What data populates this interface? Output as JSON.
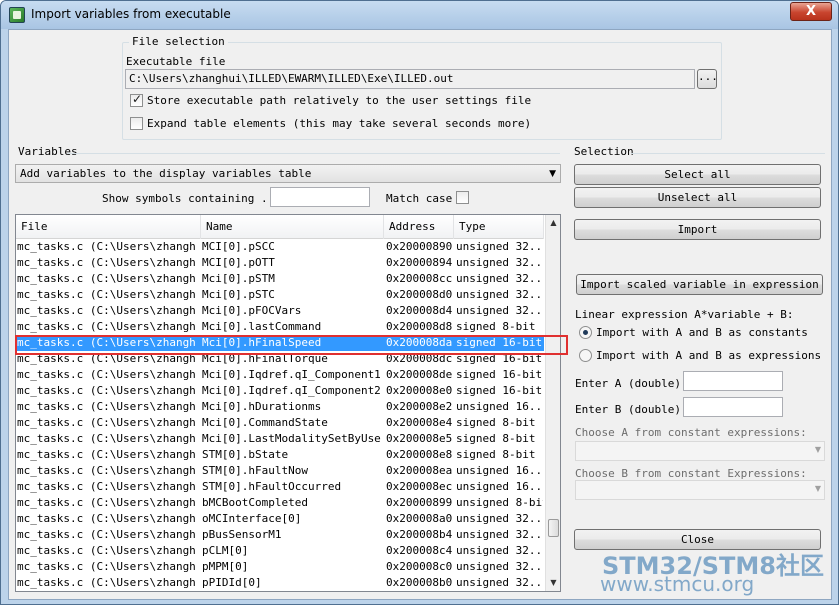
{
  "window": {
    "title": "Import variables from executable",
    "close_label": "X"
  },
  "file_selection": {
    "title": "File selection",
    "executable_label": "Executable file",
    "executable_path": "C:\\Users\\zhanghui\\ILLED\\EWARM\\ILLED\\Exe\\ILLED.out",
    "browse_label": "...",
    "store_relative_label": "Store executable path relatively to the user settings file",
    "store_relative_checked": true,
    "expand_table_label": "Expand table elements (this may take several seconds more)",
    "expand_table_checked": false
  },
  "variables": {
    "title": "Variables",
    "action_select_value": "Add variables to the display variables table",
    "show_symbols_label": "Show symbols containing ...",
    "show_symbols_value": "",
    "match_case_label": "Match case",
    "match_case_checked": false,
    "columns": [
      "File",
      "Name",
      "Address",
      "Type"
    ],
    "rows": [
      {
        "file": "mc_tasks.c (C:\\Users\\zhangh...",
        "name": "MCI[0].pSCC",
        "address": "0x20000890",
        "type": "unsigned 32..."
      },
      {
        "file": "mc_tasks.c (C:\\Users\\zhangh...",
        "name": "MCI[0].pOTT",
        "address": "0x20000894",
        "type": "unsigned 32..."
      },
      {
        "file": "mc_tasks.c (C:\\Users\\zhangh...",
        "name": "Mci[0].pSTM",
        "address": "0x200008cc",
        "type": "unsigned 32..."
      },
      {
        "file": "mc_tasks.c (C:\\Users\\zhangh...",
        "name": "Mci[0].pSTC",
        "address": "0x200008d0",
        "type": "unsigned 32..."
      },
      {
        "file": "mc_tasks.c (C:\\Users\\zhangh...",
        "name": "Mci[0].pFOCVars",
        "address": "0x200008d4",
        "type": "unsigned 32..."
      },
      {
        "file": "mc_tasks.c (C:\\Users\\zhangh...",
        "name": "Mci[0].lastCommand",
        "address": "0x200008d8",
        "type": "signed 8-bit"
      },
      {
        "file": "mc_tasks.c (C:\\Users\\zhangh...",
        "name": "Mci[0].hFinalSpeed",
        "address": "0x200008da",
        "type": "signed 16-bit",
        "selected": true
      },
      {
        "file": "mc_tasks.c (C:\\Users\\zhangh...",
        "name": "Mci[0].hFinalTorque",
        "address": "0x200008dc",
        "type": "signed 16-bit"
      },
      {
        "file": "mc_tasks.c (C:\\Users\\zhangh...",
        "name": "Mci[0].Iqdref.qI_Component1",
        "address": "0x200008de",
        "type": "signed 16-bit"
      },
      {
        "file": "mc_tasks.c (C:\\Users\\zhangh...",
        "name": "Mci[0].Iqdref.qI_Component2",
        "address": "0x200008e0",
        "type": "signed 16-bit"
      },
      {
        "file": "mc_tasks.c (C:\\Users\\zhangh...",
        "name": "Mci[0].hDurationms",
        "address": "0x200008e2",
        "type": "unsigned 16..."
      },
      {
        "file": "mc_tasks.c (C:\\Users\\zhangh...",
        "name": "Mci[0].CommandState",
        "address": "0x200008e4",
        "type": "signed 8-bit"
      },
      {
        "file": "mc_tasks.c (C:\\Users\\zhangh...",
        "name": "Mci[0].LastModalitySetByUser",
        "address": "0x200008e5",
        "type": "signed 8-bit"
      },
      {
        "file": "mc_tasks.c (C:\\Users\\zhangh...",
        "name": "STM[0].bState",
        "address": "0x200008e8",
        "type": "signed 8-bit"
      },
      {
        "file": "mc_tasks.c (C:\\Users\\zhangh...",
        "name": "STM[0].hFaultNow",
        "address": "0x200008ea",
        "type": "unsigned 16..."
      },
      {
        "file": "mc_tasks.c (C:\\Users\\zhangh...",
        "name": "STM[0].hFaultOccurred",
        "address": "0x200008ec",
        "type": "unsigned 16..."
      },
      {
        "file": "mc_tasks.c (C:\\Users\\zhangh...",
        "name": "bMCBootCompleted",
        "address": "0x20000899",
        "type": "unsigned 8-bit"
      },
      {
        "file": "mc_tasks.c (C:\\Users\\zhangh...",
        "name": "oMCInterface[0]",
        "address": "0x200008a0",
        "type": "unsigned 32..."
      },
      {
        "file": "mc_tasks.c (C:\\Users\\zhangh...",
        "name": "pBusSensorM1",
        "address": "0x200008b4",
        "type": "unsigned 32..."
      },
      {
        "file": "mc_tasks.c (C:\\Users\\zhangh...",
        "name": "pCLM[0]",
        "address": "0x200008c4",
        "type": "unsigned 32..."
      },
      {
        "file": "mc_tasks.c (C:\\Users\\zhangh...",
        "name": "pMPM[0]",
        "address": "0x200008c0",
        "type": "unsigned 32..."
      },
      {
        "file": "mc_tasks.c (C:\\Users\\zhangh...",
        "name": "pPIDId[0]",
        "address": "0x200008b0",
        "type": "unsigned 32..."
      }
    ],
    "scroll_up": "▲",
    "scroll_down": "▼"
  },
  "selection": {
    "title": "Selection",
    "select_all": "Select all",
    "unselect_all": "Unselect all",
    "import": "Import",
    "import_scaled": "Import scaled variable in expression",
    "linear_expr_label": "Linear expression A*variable + B:",
    "radio_constants": "Import with A and B as constants",
    "radio_expressions": "Import with A and B as expressions",
    "enter_a_label": "Enter A (double):",
    "enter_a_value": "",
    "enter_b_label": "Enter B (double):",
    "enter_b_value": "",
    "choose_a_label": "Choose A from constant expressions:",
    "choose_b_label": "Choose B from constant Expressions:",
    "close": "Close"
  },
  "watermark": {
    "title": "STM32/STM8社区",
    "url": "www.stmcu.org"
  }
}
